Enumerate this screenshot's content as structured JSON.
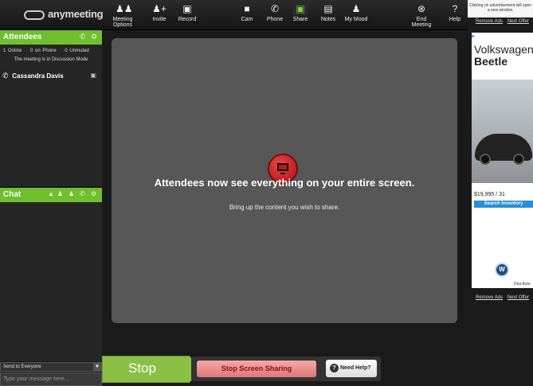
{
  "app": {
    "logo_text": "anymeeting"
  },
  "toolbar": [
    {
      "label": "Meeting Options",
      "icon": "people-icon"
    },
    {
      "label": "Invite",
      "icon": "add-person-icon"
    },
    {
      "label": "Record",
      "icon": "record-icon"
    },
    {
      "label": "Cam",
      "icon": "camera-icon"
    },
    {
      "label": "Phone",
      "icon": "phone-icon"
    },
    {
      "label": "Share",
      "icon": "monitor-icon",
      "active": true
    },
    {
      "label": "Notes",
      "icon": "notes-icon"
    },
    {
      "label": "My Mood",
      "icon": "person-icon"
    },
    {
      "label": "End Meeting",
      "icon": "end-icon"
    },
    {
      "label": "Help",
      "icon": "help-icon"
    }
  ],
  "attendees": {
    "header": "Attendees",
    "stats": {
      "online": "1 Online",
      "phone": "0 on Phone",
      "unmuted": "0 Unmuted"
    },
    "mode_note": "The meeting is in Discussion Mode",
    "list": [
      {
        "name": "Cassandra Davis"
      }
    ]
  },
  "chat": {
    "header": "Chat",
    "send_to": "Send to Everyone",
    "input_placeholder": "Type your message here..."
  },
  "share": {
    "headline": "Attendees now see everything on your entire screen.",
    "subline": "Bring up the content you wish to share."
  },
  "bottom": {
    "stop_tag": "Stop",
    "stop_button": "Stop Screen Sharing",
    "help_button": "Need Help?"
  },
  "ad": {
    "notice": "Clicking on advertisement will open a new window.",
    "remove_ads": "Remove Ads",
    "next_offer": "Next Offer",
    "title_line1": "Volkswagen",
    "title_line2": "Beetle",
    "price": "$19,995 / 31",
    "search": "Search Inventory",
    "dealer": "Dea Auto"
  },
  "colors": {
    "accent_green": "#6fbf2f",
    "stop_red": "#e07777",
    "panel_gray": "#575757"
  }
}
